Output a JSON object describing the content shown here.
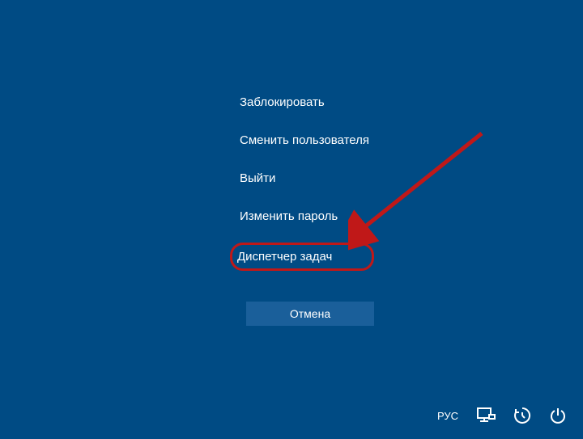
{
  "menu": {
    "items": [
      {
        "label": "Заблокировать"
      },
      {
        "label": "Сменить пользователя"
      },
      {
        "label": "Выйти"
      },
      {
        "label": "Изменить пароль"
      },
      {
        "label": "Диспетчер задач"
      }
    ],
    "cancel_label": "Отмена"
  },
  "tray": {
    "language": "РУС"
  }
}
